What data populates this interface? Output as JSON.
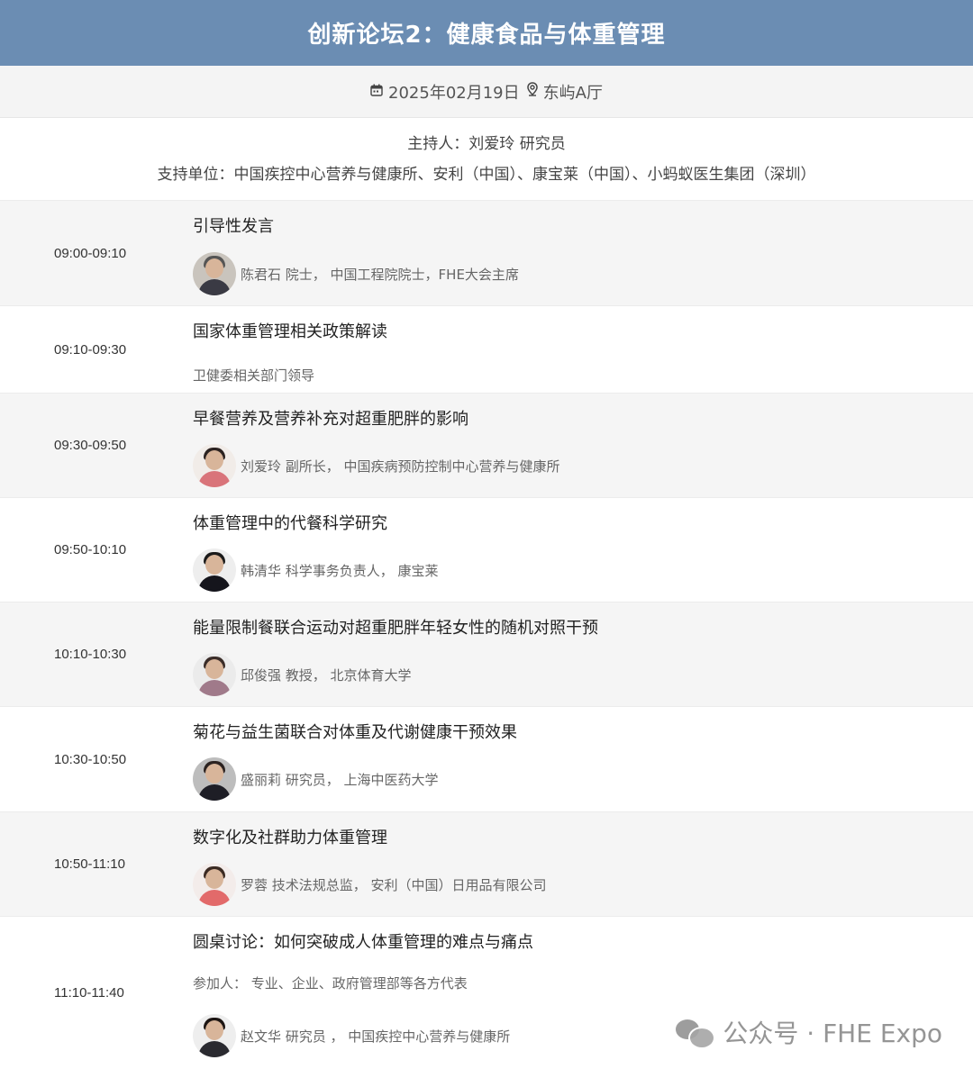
{
  "header": {
    "title": "创新论坛2：健康食品与体重管理"
  },
  "meta": {
    "date": "2025年02月19日",
    "location": "东屿A厅"
  },
  "host": {
    "moderator": "主持人：刘爱玲 研究员",
    "supporters": "支持单位：中国疾控中心营养与健康所、安利（中国）、康宝莱（中国）、小蚂蚁医生集团（深圳）"
  },
  "agenda": [
    {
      "time": "09:00-09:10",
      "title": "引导性发言",
      "speaker": "陈君石 院士， 中国工程院院士，FHE大会主席"
    },
    {
      "time": "09:10-09:30",
      "title": "国家体重管理相关政策解读",
      "note": "卫健委相关部门领导"
    },
    {
      "time": "09:30-09:50",
      "title": "早餐营养及营养补充对超重肥胖的影响",
      "speaker": "刘爱玲 副所长， 中国疾病预防控制中心营养与健康所"
    },
    {
      "time": "09:50-10:10",
      "title": "体重管理中的代餐科学研究",
      "speaker": "韩清华 科学事务负责人， 康宝莱"
    },
    {
      "time": "10:10-10:30",
      "title": "能量限制餐联合运动对超重肥胖年轻女性的随机对照干预",
      "speaker": "邱俊强 教授， 北京体育大学"
    },
    {
      "time": "10:30-10:50",
      "title": "菊花与益生菌联合对体重及代谢健康干预效果",
      "speaker": "盛丽莉 研究员， 上海中医药大学"
    },
    {
      "time": "10:50-11:10",
      "title": "数字化及社群助力体重管理",
      "speaker": "罗蓉 技术法规总监， 安利（中国）日用品有限公司"
    },
    {
      "time": "11:10-11:40",
      "title": "圆桌讨论：如何突破成人体重管理的难点与痛点",
      "note": "参加人： 专业、企业、政府管理部等各方代表",
      "speaker": "赵文华 研究员 ， 中国疾控中心营养与健康所"
    }
  ],
  "watermark": {
    "text": "公众号 · FHE Expo"
  },
  "icons": {
    "calendar": "calendar-icon",
    "location": "location-pin-icon",
    "wechat": "wechat-icon"
  }
}
